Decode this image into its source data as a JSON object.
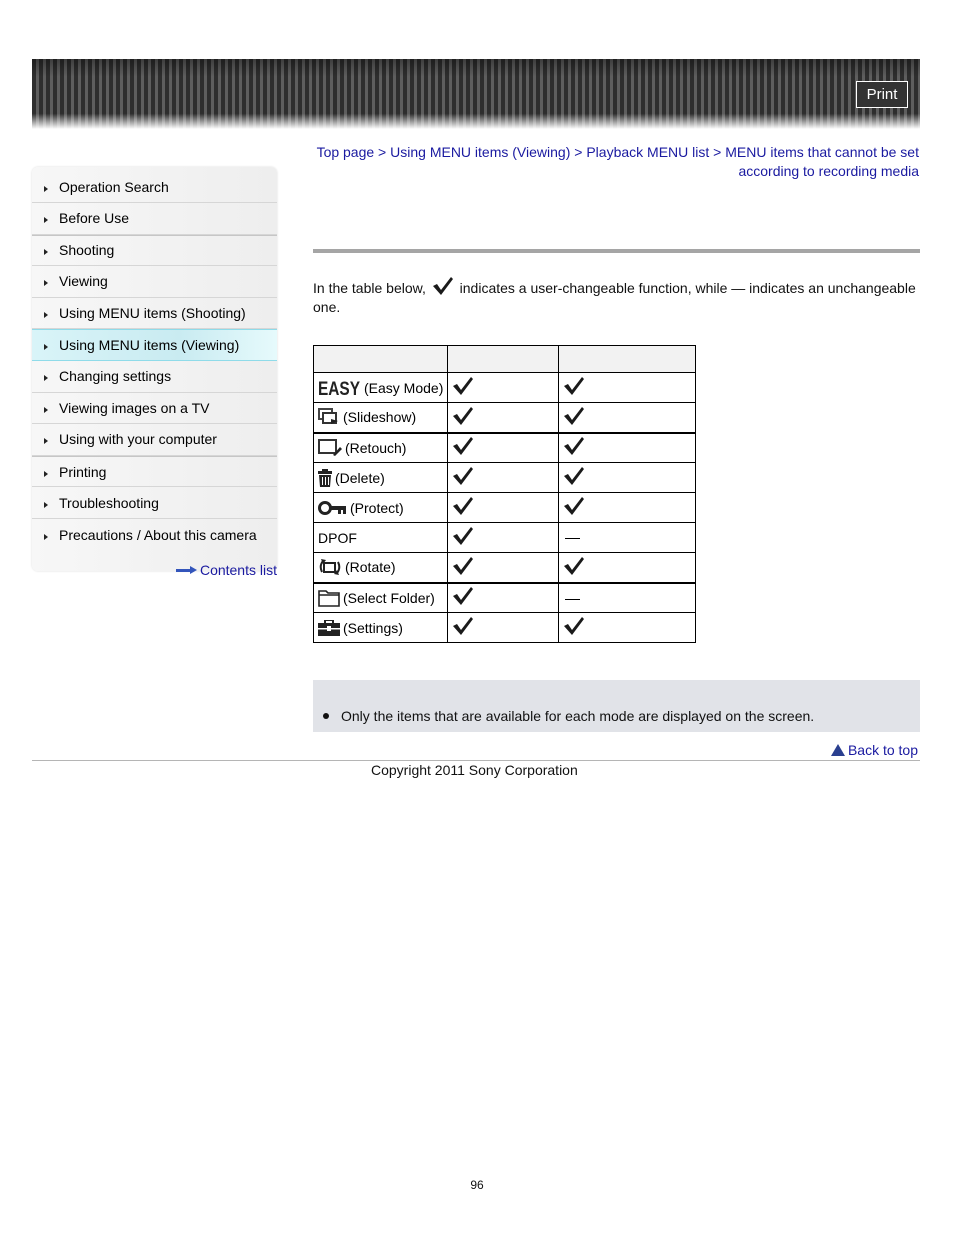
{
  "header": {
    "print_label": "Print"
  },
  "sidebar": {
    "items": [
      {
        "label": "Operation Search"
      },
      {
        "label": "Before Use"
      },
      {
        "label": "Shooting"
      },
      {
        "label": "Viewing"
      },
      {
        "label": "Using MENU items (Shooting)"
      },
      {
        "label": "Using MENU items (Viewing)",
        "active": true
      },
      {
        "label": "Changing settings"
      },
      {
        "label": "Viewing images on a TV"
      },
      {
        "label": "Using with your computer"
      },
      {
        "label": "Printing"
      },
      {
        "label": "Troubleshooting"
      },
      {
        "label": "Precautions / About this camera"
      }
    ],
    "contents_link": "Contents list"
  },
  "breadcrumb": {
    "items": [
      "Top page",
      "Using MENU items (Viewing)",
      "Playback MENU list",
      "MENU items that cannot be set according to recording media"
    ],
    "separator": " > "
  },
  "intro": {
    "before": "In the table below,",
    "after": " indicates a user-changeable function, while — indicates an unchangeable one."
  },
  "table": {
    "headers": [
      "",
      "",
      ""
    ],
    "rows": [
      {
        "icon": "easy-icon",
        "label": "(Easy Mode)",
        "col2": "check",
        "col3": "check"
      },
      {
        "icon": "slideshow-icon",
        "label": "(Slideshow)",
        "col2": "check",
        "col3": "check"
      },
      {
        "icon": "retouch-icon",
        "label": "(Retouch)",
        "col2": "check",
        "col3": "check"
      },
      {
        "icon": "delete-icon",
        "label": "(Delete)",
        "col2": "check",
        "col3": "check"
      },
      {
        "icon": "protect-icon",
        "label": "(Protect)",
        "col2": "check",
        "col3": "check"
      },
      {
        "icon": "",
        "label": "DPOF",
        "col2": "check",
        "col3": "dash"
      },
      {
        "icon": "rotate-icon",
        "label": "(Rotate)",
        "col2": "check",
        "col3": "check"
      },
      {
        "icon": "folder-icon",
        "label": "(Select Folder)",
        "col2": "check",
        "col3": "dash"
      },
      {
        "icon": "settings-icon",
        "label": "(Settings)",
        "col2": "check",
        "col3": "check"
      }
    ]
  },
  "note": {
    "items": [
      "Only the items that are available for each mode are displayed on the screen."
    ]
  },
  "footer": {
    "back_to_top": "Back to top",
    "copyright": "Copyright 2011 Sony Corporation",
    "page_number": "96"
  }
}
